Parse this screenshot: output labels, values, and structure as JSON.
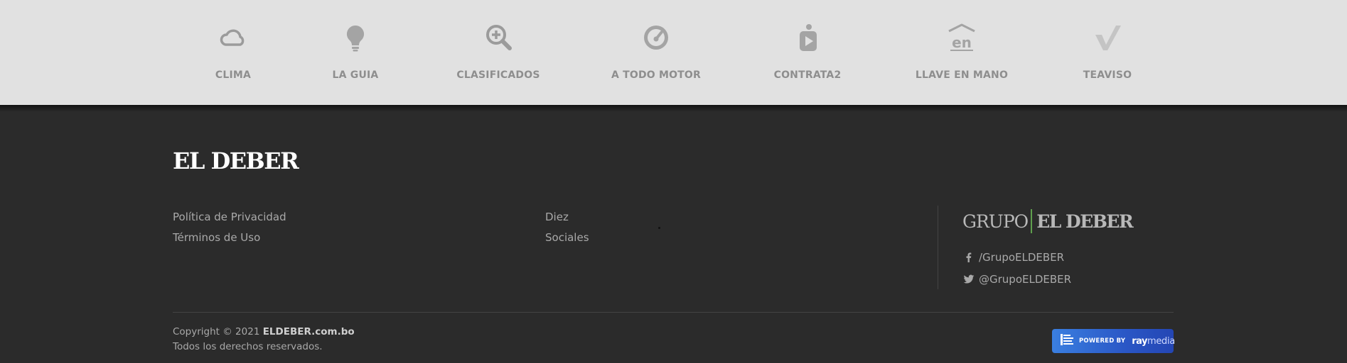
{
  "services": [
    {
      "label": "CLIMA",
      "icon": "cloud-icon"
    },
    {
      "label": "LA GUIA",
      "icon": "lightbulb-icon"
    },
    {
      "label": "CLASIFICADOS",
      "icon": "magnifier-plus-icon"
    },
    {
      "label": "A TODO MOTOR",
      "icon": "speedometer-icon"
    },
    {
      "label": "CONTRATA2",
      "icon": "person-play-icon"
    },
    {
      "label": "LLAVE EN MANO",
      "icon": "house-en-icon"
    },
    {
      "label": "TEAVISO",
      "icon": "checkmark-icon"
    }
  ],
  "footer": {
    "logo": "EL DEBER",
    "col1": [
      "Política de Privacidad",
      "Términos de Uso"
    ],
    "col2": [
      "Diez",
      "Sociales"
    ],
    "group": {
      "part1": "GRUPO",
      "part2": "EL DEBER"
    },
    "facebook": "/GrupoELDEBER",
    "twitter": "@GrupoELDEBER",
    "copyright_prefix": "Copyright © 2021",
    "copyright_site": "ELDEBER.com.bo",
    "rights": "Todos los derechos reservados.",
    "powered_by": "POWERED BY",
    "powered_brand_a": "ray",
    "powered_brand_b": "media"
  },
  "colors": {
    "service_bar": "#e1e1e1",
    "service_text": "#8e8e8e",
    "footer_bg": "#2b2b2b",
    "footer_text": "#a9a9a9",
    "group_accent": "#5f9e4d",
    "powered_badge": "#2a57c6"
  }
}
